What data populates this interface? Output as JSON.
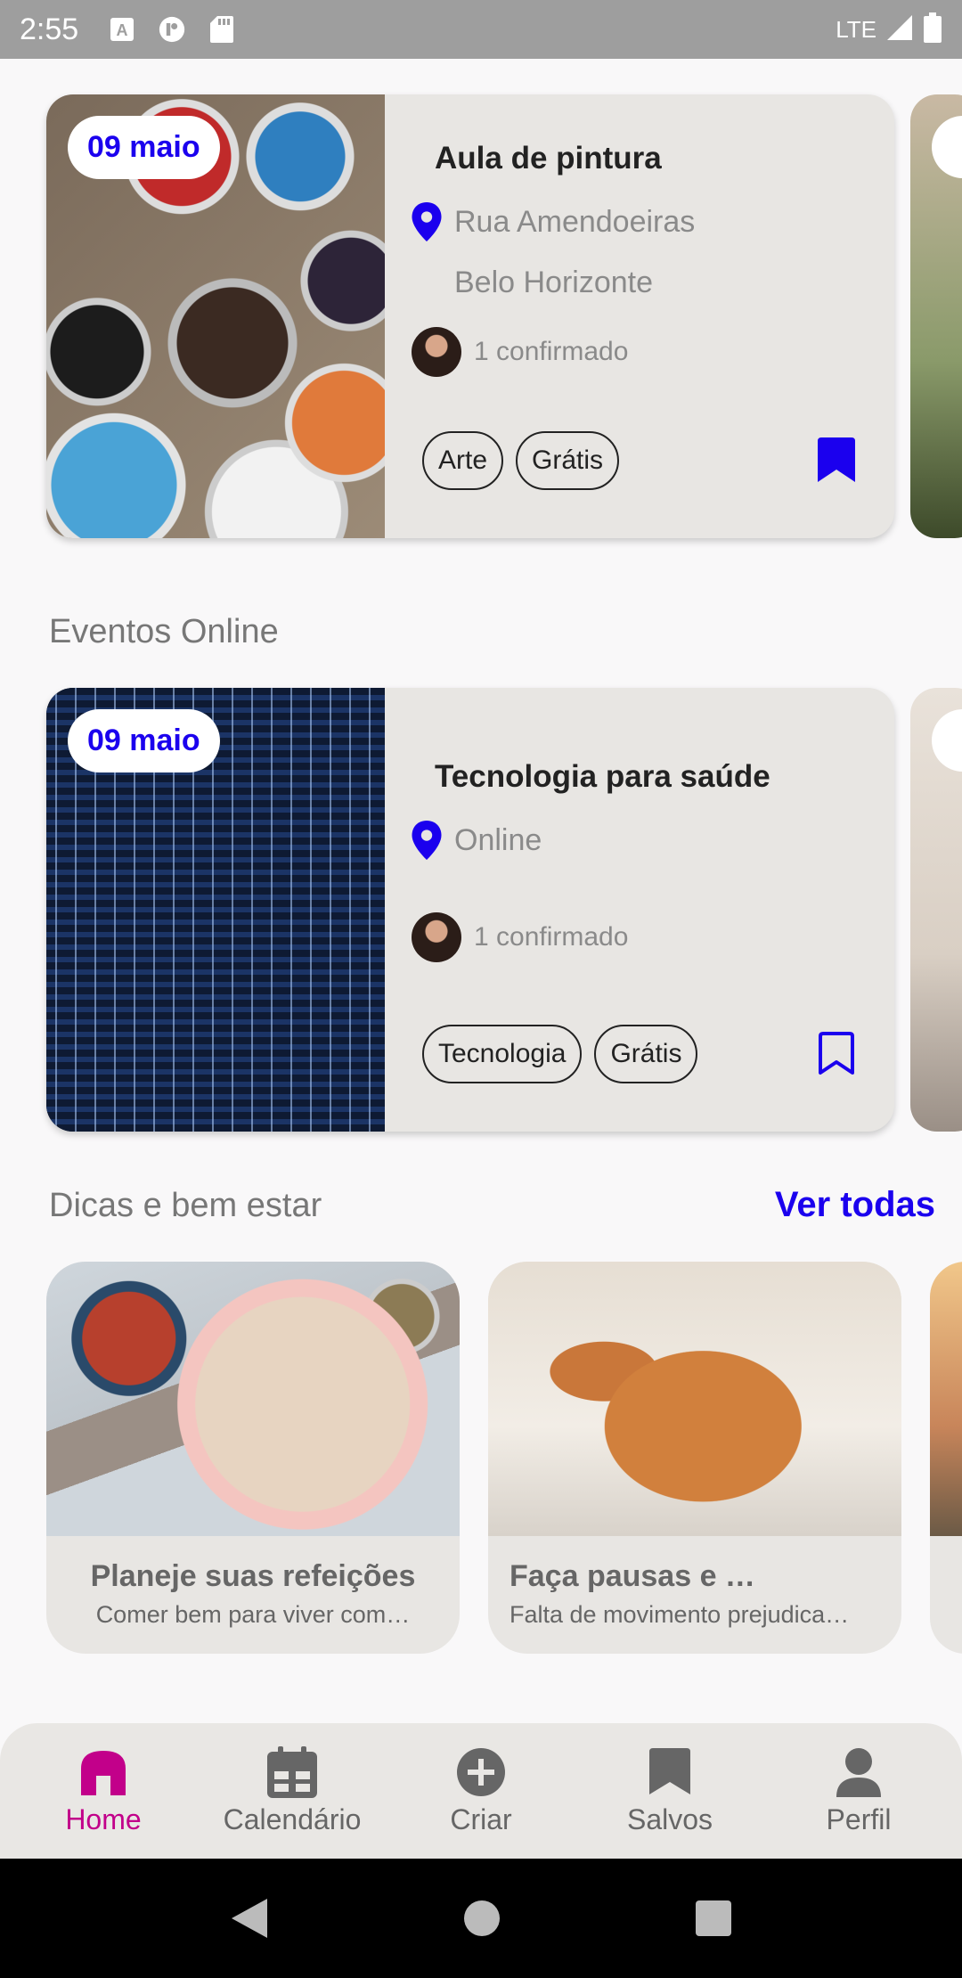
{
  "status_bar": {
    "time": "2:55",
    "network": "LTE"
  },
  "events": [
    {
      "date": "09 maio",
      "title": "Aula de pintura",
      "location_line1": "Rua Amendoeiras",
      "location_line2": "Belo Horizonte",
      "confirmed": "1 confirmado",
      "tags": [
        "Arte",
        "Grátis"
      ],
      "saved": true
    }
  ],
  "online_section": {
    "title": "Eventos Online"
  },
  "online_events": [
    {
      "date": "09 maio",
      "title": "Tecnologia para saúde",
      "location_line1": "Online",
      "confirmed": "1 confirmado",
      "tags": [
        "Tecnologia",
        "Grátis"
      ],
      "saved": false
    }
  ],
  "tips_section": {
    "title": "Dicas e bem estar",
    "see_all": "Ver todas"
  },
  "tips": [
    {
      "title": "Planeje suas refeições",
      "subtitle": "Comer bem para viver com…"
    },
    {
      "title": "Faça pausas e …",
      "subtitle": "Falta de movimento prejudica…"
    }
  ],
  "bottom_nav": {
    "items": [
      {
        "label": "Home",
        "icon": "home-icon",
        "active": true
      },
      {
        "label": "Calendário",
        "icon": "calendar-icon"
      },
      {
        "label": "Criar",
        "icon": "add-circle-icon"
      },
      {
        "label": "Salvos",
        "icon": "bookmark-icon"
      },
      {
        "label": "Perfil",
        "icon": "person-icon"
      }
    ]
  },
  "colors": {
    "accent_blue": "#1b00ee",
    "accent_magenta": "#c2008a",
    "card_bg": "#e8e6e3"
  }
}
